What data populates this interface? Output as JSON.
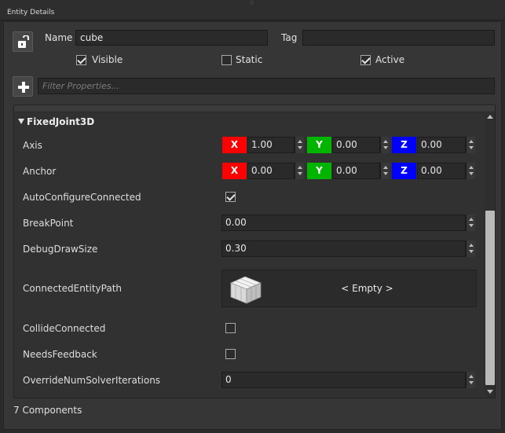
{
  "panel": {
    "title": "Entity Details"
  },
  "entity": {
    "name_label": "Name",
    "name_value": "cube",
    "tag_label": "Tag",
    "tag_value": "",
    "visible_label": "Visible",
    "visible_checked": true,
    "static_label": "Static",
    "static_checked": false,
    "active_label": "Active",
    "active_checked": true
  },
  "filter": {
    "placeholder": "Filter Properties..."
  },
  "component": {
    "name": "FixedJoint3D",
    "axis_label": "Axis",
    "axis": {
      "x": "1.00",
      "y": "0.00",
      "z": "0.00"
    },
    "anchor_label": "Anchor",
    "anchor": {
      "x": "0.00",
      "y": "0.00",
      "z": "0.00"
    },
    "x_label": "X",
    "y_label": "Y",
    "z_label": "Z",
    "auto_configure_label": "AutoConfigureConnected",
    "auto_configure_checked": true,
    "break_point_label": "BreakPoint",
    "break_point_value": "0.00",
    "debug_draw_size_label": "DebugDrawSize",
    "debug_draw_size_value": "0.30",
    "connected_entity_label": "ConnectedEntityPath",
    "connected_entity_value": "< Empty >",
    "collide_connected_label": "CollideConnected",
    "collide_connected_checked": false,
    "needs_feedback_label": "NeedsFeedback",
    "needs_feedback_checked": false,
    "override_iterations_label": "OverrideNumSolverIterations",
    "override_iterations_value": "0"
  },
  "footer": {
    "components_count": "7 Components"
  },
  "colors": {
    "axis_x": "#ff0000",
    "axis_y": "#00b400",
    "axis_z": "#0000ff",
    "panel_bg": "#363636"
  },
  "icons": {
    "lock": "lock-icon",
    "add": "plus-icon",
    "entity_thumb": "cube-icon"
  }
}
